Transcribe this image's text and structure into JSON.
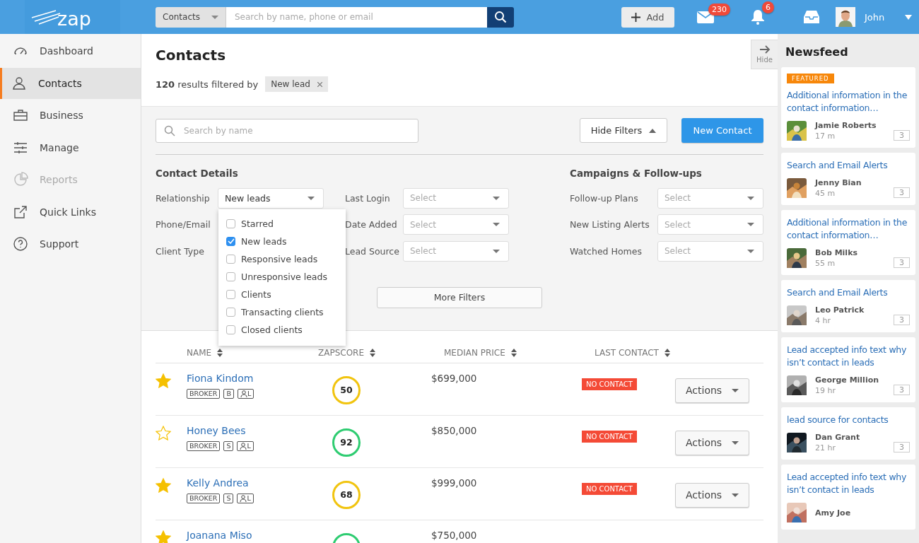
{
  "header": {
    "logo": "zap",
    "search_scope": "Contacts",
    "search_placeholder": "Search by name, phone or email",
    "add_button": "Add",
    "mail_count": "230",
    "notification_count": "6",
    "user_name": "John"
  },
  "sidebar": {
    "items": [
      {
        "label": "Dashboard",
        "selected": false,
        "disabled": false
      },
      {
        "label": "Contacts",
        "selected": true,
        "disabled": false
      },
      {
        "label": "Business",
        "selected": false,
        "disabled": false
      },
      {
        "label": "Manage",
        "selected": false,
        "disabled": false
      },
      {
        "label": "Reports",
        "selected": false,
        "disabled": true
      },
      {
        "label": "Quick Links",
        "selected": false,
        "disabled": false
      },
      {
        "label": "Support",
        "selected": false,
        "disabled": false
      }
    ]
  },
  "page": {
    "title": "Contacts",
    "results": "**120** results filtered by",
    "filter_chips": [
      "New lead"
    ]
  },
  "filters": {
    "search_placeholder": "Search by name",
    "hide_button": "Hide Filters",
    "new_button": "New Contact",
    "more_button": "More Filters",
    "groups": [
      {
        "title": "Contact Details",
        "fields": [
          {
            "label": "Relationship",
            "value": "New leads",
            "open": true
          },
          {
            "label": "Phone/Email"
          },
          {
            "label": "Client Type"
          }
        ]
      },
      {
        "fields": [
          {
            "label": "Last Login",
            "placeholder": "Select"
          },
          {
            "label": "Date Added",
            "placeholder": "Select"
          },
          {
            "label": "Lead Source",
            "placeholder": "Select"
          }
        ]
      },
      {
        "title": "Campaigns & Follow-ups",
        "fields": [
          {
            "label": "Follow-up Plans",
            "placeholder": "Select"
          },
          {
            "label": "New Listing Alerts",
            "placeholder": "Select"
          },
          {
            "label": "Watched Homes",
            "placeholder": "Select"
          }
        ]
      }
    ],
    "dropdown_options": [
      {
        "label": "Starred",
        "checked": false
      },
      {
        "label": "New leads",
        "checked": true
      },
      {
        "label": "Responsive leads",
        "checked": false
      },
      {
        "label": "Unresponsive leads",
        "checked": false
      },
      {
        "label": "Clients",
        "checked": false
      },
      {
        "label": "Transacting clients",
        "checked": false
      },
      {
        "label": "Closed clients",
        "checked": false
      }
    ]
  },
  "table": {
    "columns": [
      "NAME",
      "ZAPSCORE",
      "MEDIAN PRICE",
      "LAST CONTACT"
    ],
    "rows": [
      {
        "starred": true,
        "name": "Fiona Kindom",
        "tags": [
          {
            "kind": "text",
            "label": "BROKER"
          },
          {
            "kind": "text",
            "label": "B"
          },
          {
            "kind": "person",
            "label": "L"
          }
        ],
        "score": "50",
        "color": "#f1c40f",
        "price": "$699,000",
        "last_contact": "NO CONTACT",
        "action": "Actions"
      },
      {
        "starred": false,
        "name": "Honey Bees",
        "tags": [
          {
            "kind": "text",
            "label": "BROKER"
          },
          {
            "kind": "text",
            "label": "S"
          },
          {
            "kind": "person",
            "label": "L"
          }
        ],
        "score": "92",
        "color": "#2ecc71",
        "price": "$850,000",
        "last_contact": "NO CONTACT",
        "action": "Actions"
      },
      {
        "starred": true,
        "name": "Kelly Andrea",
        "tags": [
          {
            "kind": "text",
            "label": "BROKER"
          },
          {
            "kind": "text",
            "label": "S"
          },
          {
            "kind": "person",
            "label": "L"
          }
        ],
        "score": "68",
        "color": "#f1c40f",
        "price": "$999,000",
        "last_contact": "NO CONTACT",
        "action": "Actions"
      },
      {
        "starred": true,
        "name": "Joanana Miso",
        "color": "#2ecc71",
        "price": "$750,000"
      }
    ]
  },
  "newsfeed": {
    "hide_button": "Hide",
    "title": "Newsfeed",
    "items": [
      {
        "badge": "FEATURED",
        "title": "Additional information in the contact information…",
        "author": "Jamie Roberts",
        "time": "17 m",
        "comments": "3"
      },
      {
        "title": "Search and Email Alerts",
        "author": "Jenny Bian",
        "time": "45 m",
        "comments": "3"
      },
      {
        "title": "Additional information in the contact information…",
        "author": "Bob Milks",
        "time": "55 m",
        "comments": "3"
      },
      {
        "title": "Search and Email Alerts",
        "author": "Leo Patrick",
        "time": "4 hr",
        "comments": "3"
      },
      {
        "title": "Lead accepted info text why isn’t contact in leads",
        "author": "George Million",
        "time": "19 hr",
        "comments": "3"
      },
      {
        "title": "lead source for contacts",
        "author": "Dan Grant",
        "time": "21 hr",
        "comments": "3"
      },
      {
        "title": "Lead accepted info text why isn’t contact in leads",
        "author": "Amy Joe"
      }
    ]
  }
}
